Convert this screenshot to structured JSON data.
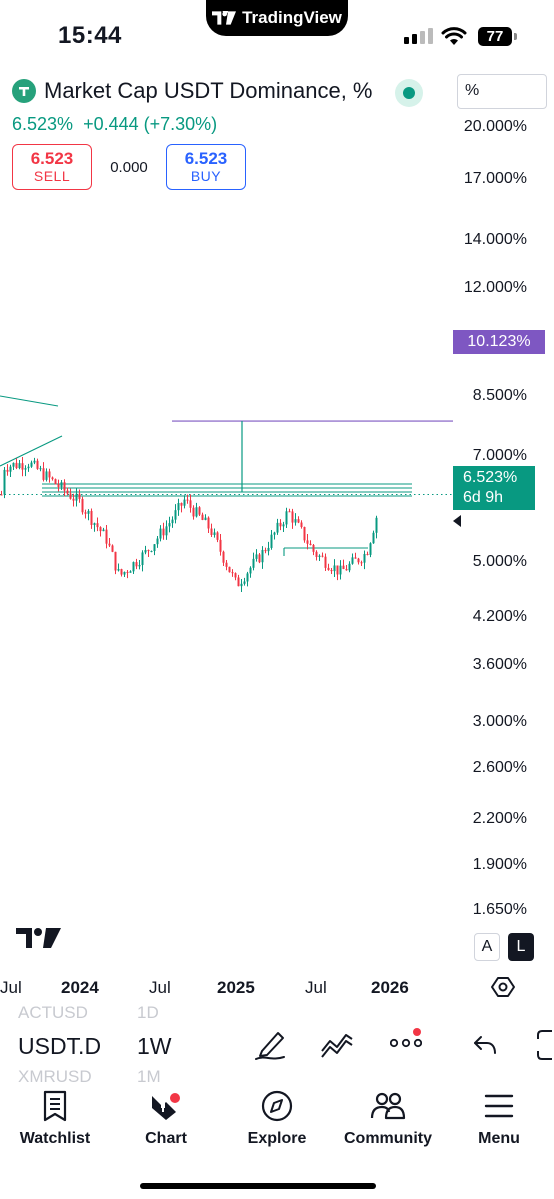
{
  "status_bar": {
    "time": "15:44",
    "battery": "77",
    "island_brand": "TradingView"
  },
  "header": {
    "symbol_title": "Market Cap USDT Dominance, %",
    "unit_selector": "%",
    "last_price": "6.523%",
    "change": "+0.444 (+7.30%)",
    "sell_price": "6.523",
    "sell_label": "SELL",
    "spread": "0.000",
    "buy_price": "6.523",
    "buy_label": "BUY"
  },
  "price_axis": {
    "labels": [
      "20.000%",
      "17.000%",
      "14.000%",
      "12.000%",
      "8.500%",
      "7.000%",
      "5.000%",
      "4.200%",
      "3.600%",
      "3.000%",
      "2.600%",
      "2.200%",
      "1.900%",
      "1.650%"
    ],
    "target_tag": "10.123%",
    "current_tag": "6.523%",
    "countdown": "6d 9h"
  },
  "scale_buttons": {
    "auto": "A",
    "log": "L"
  },
  "time_axis": [
    "Jul",
    "2024",
    "Jul",
    "2025",
    "Jul",
    "2026"
  ],
  "toolbar": {
    "symbol": "USDT.D",
    "interval": "1W",
    "ghost_symbol_above": "ACTUSD",
    "ghost_interval_above": "1D",
    "ghost_symbol_below": "XMRUSD",
    "ghost_interval_below": "1M"
  },
  "nav": {
    "watchlist": "Watchlist",
    "chart": "Chart",
    "explore": "Explore",
    "community": "Community",
    "menu": "Menu"
  },
  "colors": {
    "up": "#089981",
    "down": "#f23645",
    "target_line": "#7e57c2",
    "buy": "#2962ff"
  },
  "chart_data": {
    "type": "candlestick",
    "symbol": "USDT.D",
    "interval": "1W",
    "scale": "log",
    "ylim": [
      1.6,
      22
    ],
    "x_ticks": [
      "Jul",
      "2024",
      "Jul",
      "2025",
      "Jul",
      "2026"
    ],
    "current_value": 6.523,
    "target_value": 10.123,
    "close_approx": [
      {
        "period": "2023-06",
        "value": 7.7
      },
      {
        "period": "2023-08",
        "value": 7.9
      },
      {
        "period": "2023-10",
        "value": 7.0
      },
      {
        "period": "2023-12",
        "value": 6.2
      },
      {
        "period": "2024-02",
        "value": 5.0
      },
      {
        "period": "2024-03",
        "value": 4.0
      },
      {
        "period": "2024-05",
        "value": 4.6
      },
      {
        "period": "2024-07",
        "value": 5.6
      },
      {
        "period": "2024-08",
        "value": 6.3
      },
      {
        "period": "2024-10",
        "value": 5.3
      },
      {
        "period": "2024-12",
        "value": 3.8
      },
      {
        "period": "2025-02",
        "value": 4.6
      },
      {
        "period": "2025-04",
        "value": 5.9
      },
      {
        "period": "2025-06",
        "value": 4.6
      },
      {
        "period": "2025-08",
        "value": 4.1
      },
      {
        "period": "2025-10",
        "value": 4.6
      },
      {
        "period": "2025-11",
        "value": 6.1
      },
      {
        "period": "2025-12",
        "value": 6.523
      }
    ]
  }
}
